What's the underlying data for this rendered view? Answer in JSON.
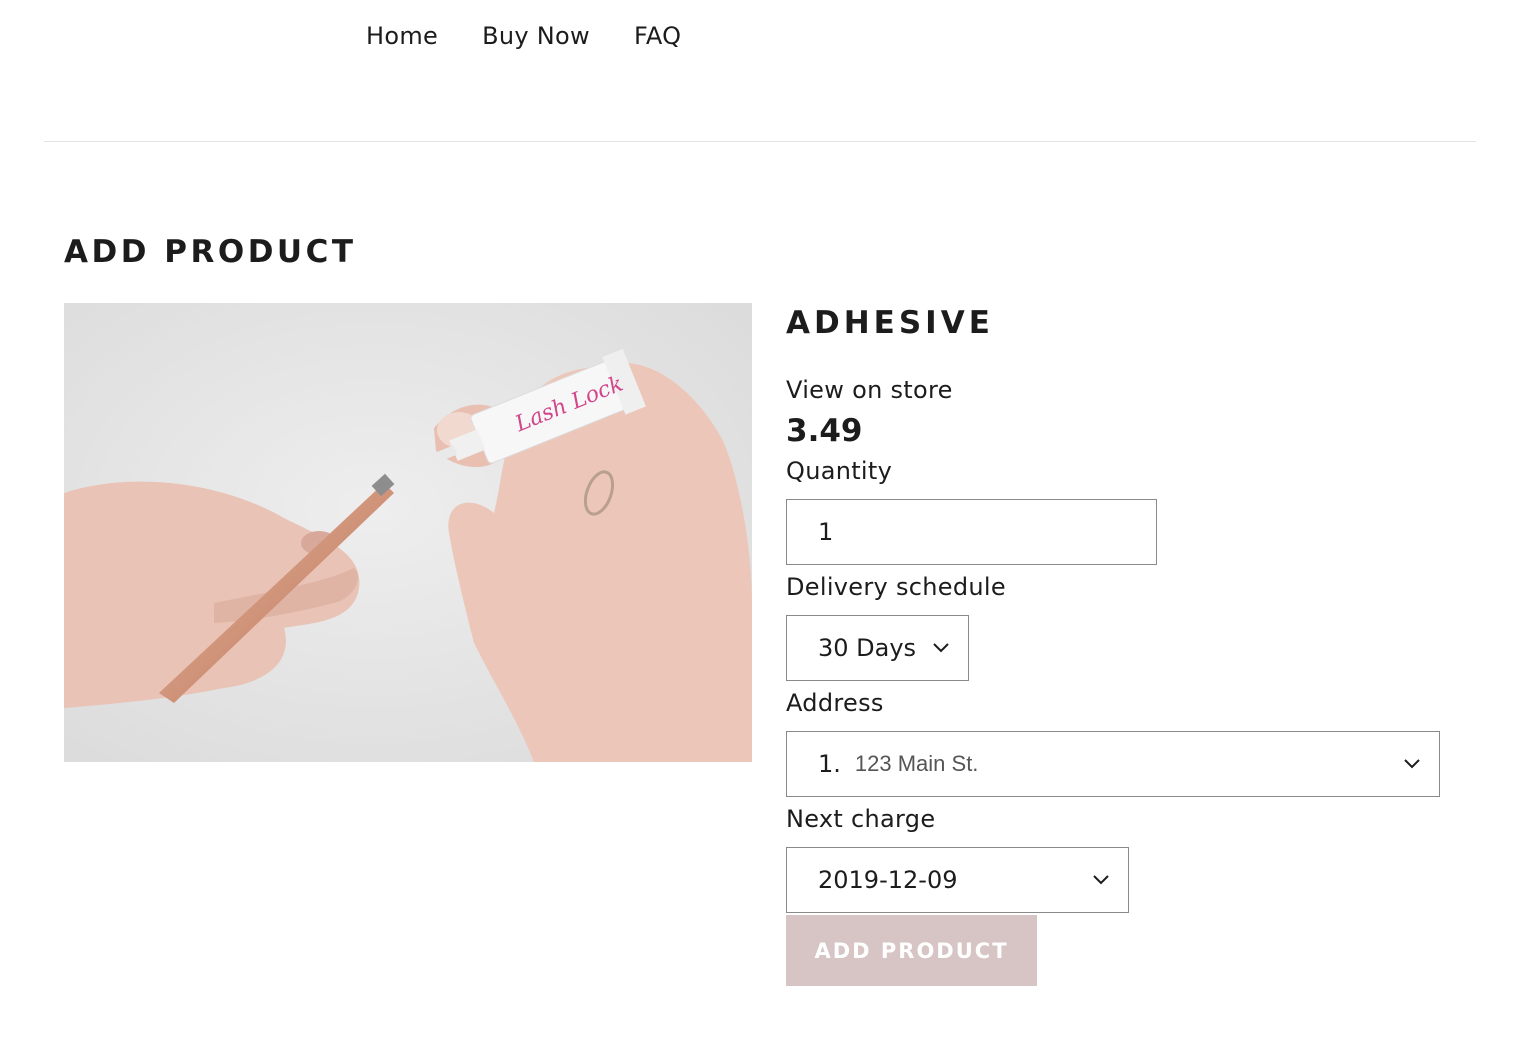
{
  "nav": {
    "items": [
      "Home",
      "Buy Now",
      "FAQ"
    ]
  },
  "page": {
    "title": "ADD PRODUCT"
  },
  "product": {
    "name": "ADHESIVE",
    "store_link": "View on store",
    "price": "3.49",
    "image_label": "Lash Lock"
  },
  "form": {
    "quantity_label": "Quantity",
    "quantity_value": "1",
    "delivery_label": "Delivery schedule",
    "delivery_value": "30 Days",
    "address_label": "Address",
    "address_number": "1.",
    "address_value": "123 Main St.",
    "next_charge_label": "Next charge",
    "next_charge_value": "2019-12-09",
    "submit_label": "ADD PRODUCT"
  },
  "icons": {
    "chevron": "chevron-down-icon"
  },
  "colors": {
    "button_bg": "#d6c5c4",
    "divider": "#e4e4e4",
    "text": "#1c1c1c"
  }
}
